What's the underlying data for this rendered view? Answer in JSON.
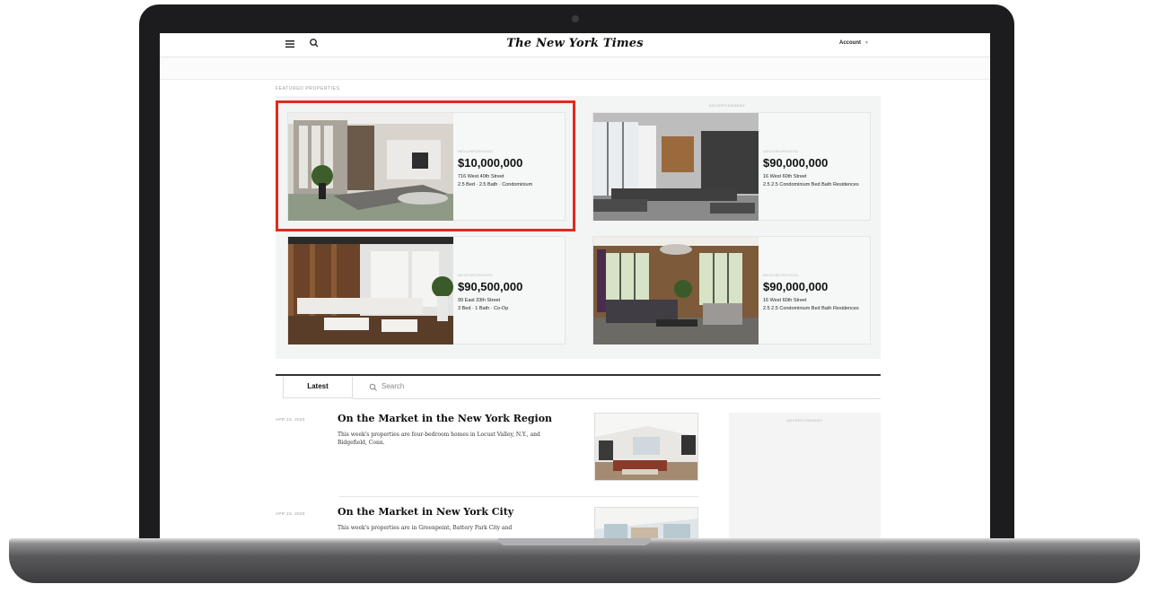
{
  "header": {
    "logo": "The New York Times",
    "account": "Account",
    "icons": [
      "menu-icon",
      "search-icon",
      "chevron-down-icon"
    ]
  },
  "featured": {
    "section_label": "FEATURED PROPERTIES",
    "ad_label_right": "ADVERTISEMENT",
    "listings": [
      {
        "neighborhood": "NEIGHBORHOOD",
        "price": "$10,000,000",
        "address": "716 West 40th Street",
        "details": "2.5 Bed · 2.5 Bath · Condominium"
      },
      {
        "neighborhood": "NEIGHBORHOOD",
        "price": "$90,000,000",
        "address": "16 West 60th Street",
        "details": "2.5    2.5    Condominium Bed    Bath    Residences"
      },
      {
        "neighborhood": "NEIGHBORHOOD",
        "price": "$90,500,000",
        "address": "99 East 33th Street",
        "details": "3 Bed · 1 Bath · Co-Op"
      },
      {
        "neighborhood": "NEIGHBORHOOD",
        "price": "$90,000,000",
        "address": "16 West 60th Street",
        "details": "2.5    2.5    Condominium Bed    Bath    Residences"
      }
    ]
  },
  "tabs": {
    "latest": "Latest",
    "search_placeholder": "Search"
  },
  "articles": [
    {
      "date": "APR 23, 2020",
      "title": "On the Market in the New York Region",
      "summary": "This week's properties are four-bedroom homes in Locust Valley, N.Y., and Ridgefield, Conn."
    },
    {
      "date": "APR 23, 2020",
      "title": "On the Market in New York City",
      "summary": "This week's properties are in Greenpoint, Battery Park City and"
    }
  ],
  "sidebar": {
    "ad_label": "ADVERTISEMENT"
  },
  "colors": {
    "highlight": "#e02a1f",
    "laptop_body": "#1c1c1e",
    "ink": "#111111"
  }
}
